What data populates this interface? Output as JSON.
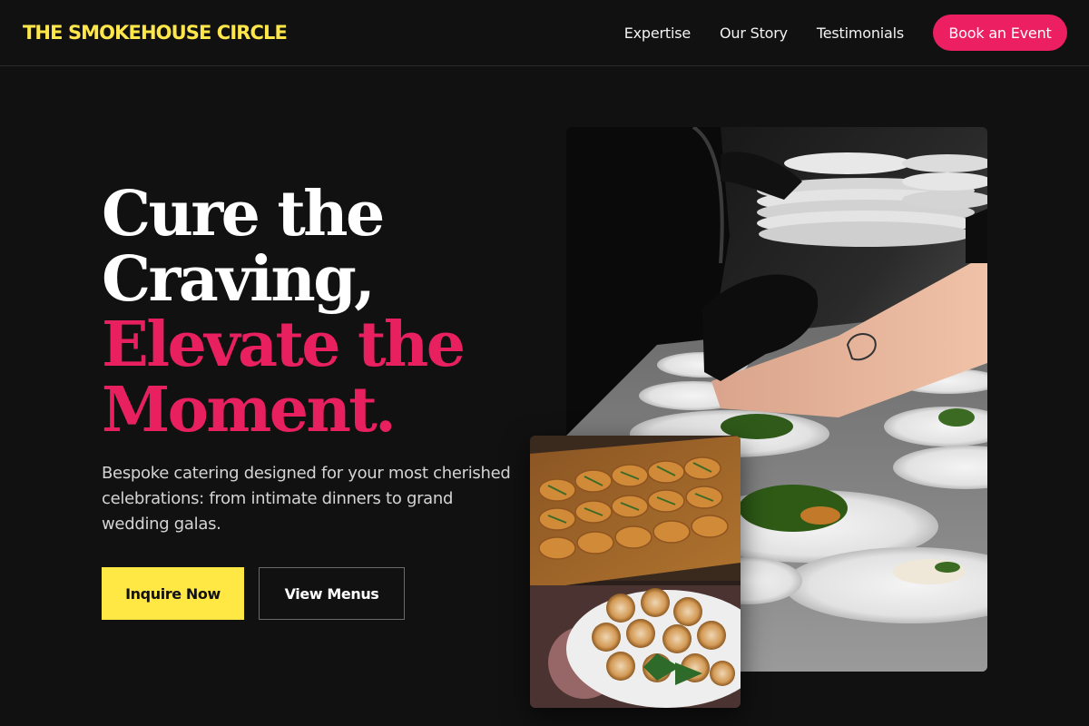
{
  "nav": {
    "brand": "THE SMOKEHOUSE CIRCLE",
    "links": [
      "Expertise",
      "Our Story",
      "Testimonials"
    ],
    "cta": "Book an Event"
  },
  "hero": {
    "headline_line1": "Cure the",
    "headline_line2": "Craving,",
    "headline_line3": "Elevate the",
    "headline_line4": "Moment.",
    "subtitle": "Bespoke catering designed for your most cherished celebrations: from intimate dinners to grand wedding galas.",
    "primary_button": "Inquire Now",
    "secondary_button": "View Menus"
  },
  "colors": {
    "background": "#121112",
    "brand_yellow": "#ffe744",
    "accent_pink": "#e8205f"
  },
  "images": {
    "main": "chef-plating-photo",
    "secondary": "pastry-platter-photo"
  }
}
